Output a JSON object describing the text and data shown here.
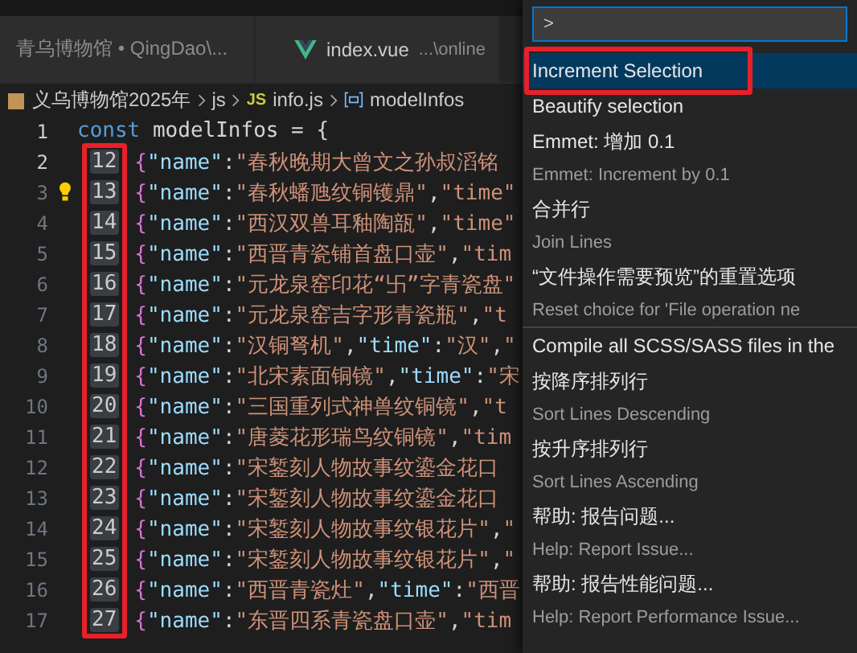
{
  "tabs": [
    {
      "label": "青乌博物馆 • QingDao\\...",
      "kind": "plain",
      "selected": false
    },
    {
      "label": "index.vue",
      "detail": "...\\online",
      "kind": "vue",
      "selected": false
    }
  ],
  "breadcrumb": [
    {
      "label": "义乌博物馆2025年",
      "kind": "folder"
    },
    {
      "label": "js",
      "kind": "plain"
    },
    {
      "label": "info.js",
      "kind": "js",
      "badge": "JS"
    },
    {
      "label": "modelInfos",
      "kind": "symbol"
    }
  ],
  "code": {
    "first_line": {
      "number": "1",
      "text": "const modelInfos = {"
    },
    "lines": [
      {
        "number": "2",
        "cursor": "12",
        "text": "{\"name\":\"春秋晚期大曾文之孙叔滔铭",
        "lightbulb": false,
        "current": true
      },
      {
        "number": "3",
        "cursor": "13",
        "text": "{\"name\":\"春秋蟠虺纹铜镬鼎\",\"time\"",
        "lightbulb": true,
        "current": false
      },
      {
        "number": "4",
        "cursor": "14",
        "text": "{\"name\":\"西汉双兽耳釉陶瓿\",\"time\"",
        "lightbulb": false,
        "current": false
      },
      {
        "number": "5",
        "cursor": "15",
        "text": "{\"name\":\"西晋青瓷铺首盘口壶\",\"tim",
        "lightbulb": false,
        "current": false
      },
      {
        "number": "6",
        "cursor": "16",
        "text": "{\"name\":\"元龙泉窑印花“卐”字青瓷盘\"",
        "lightbulb": false,
        "current": false
      },
      {
        "number": "7",
        "cursor": "17",
        "text": "{\"name\":\"元龙泉窑吉字形青瓷瓶\",\"t",
        "lightbulb": false,
        "current": false
      },
      {
        "number": "8",
        "cursor": "18",
        "text": "{\"name\":\"汉铜弩机\",\"time\":\"汉\",\"",
        "lightbulb": false,
        "current": false
      },
      {
        "number": "9",
        "cursor": "19",
        "text": "{\"name\":\"北宋素面铜镜\",\"time\":\"宋",
        "lightbulb": false,
        "current": false
      },
      {
        "number": "10",
        "cursor": "20",
        "text": "{\"name\":\"三国重列式神兽纹铜镜\",\"t",
        "lightbulb": false,
        "current": false
      },
      {
        "number": "11",
        "cursor": "21",
        "text": "{\"name\":\"唐菱花形瑞鸟纹铜镜\",\"tim",
        "lightbulb": false,
        "current": false
      },
      {
        "number": "12",
        "cursor": "22",
        "text": "{\"name\":\"宋錾刻人物故事纹鎏金花口",
        "lightbulb": false,
        "current": false
      },
      {
        "number": "13",
        "cursor": "23",
        "text": "{\"name\":\"宋錾刻人物故事纹鎏金花口",
        "lightbulb": false,
        "current": false
      },
      {
        "number": "14",
        "cursor": "24",
        "text": "{\"name\":\"宋錾刻人物故事纹银花片\",\"",
        "lightbulb": false,
        "current": false
      },
      {
        "number": "15",
        "cursor": "25",
        "text": "{\"name\":\"宋錾刻人物故事纹银花片\",\"",
        "lightbulb": false,
        "current": false
      },
      {
        "number": "16",
        "cursor": "26",
        "text": "{\"name\":\"西晋青瓷灶\",\"time\":\"西晋",
        "lightbulb": false,
        "current": false
      },
      {
        "number": "17",
        "cursor": "27",
        "text": "{\"name\":\"东晋四系青瓷盘口壶\",\"tim",
        "lightbulb": false,
        "current": false
      }
    ]
  },
  "command_palette": {
    "input": ">",
    "items": [
      {
        "label": "Increment Selection",
        "selected": true,
        "separator": false,
        "annotated": true
      },
      {
        "label": "Beautify selection",
        "selected": false,
        "separator": false,
        "annotated": false
      },
      {
        "label": "Emmet: 增加 0.1",
        "detail": "Emmet: Increment by 0.1",
        "selected": false,
        "separator": false,
        "annotated": false
      },
      {
        "label": "合并行",
        "detail": "Join Lines",
        "selected": false,
        "separator": false,
        "annotated": false
      },
      {
        "label": "“文件操作需要预览”的重置选项",
        "detail": "Reset choice for 'File operation ne",
        "selected": false,
        "separator": false,
        "annotated": false
      },
      {
        "label": "Compile all SCSS/SASS files in the",
        "selected": false,
        "separator": true,
        "annotated": false
      },
      {
        "label": "按降序排列行",
        "detail": "Sort Lines Descending",
        "selected": false,
        "separator": false,
        "annotated": false
      },
      {
        "label": "按升序排列行",
        "detail": "Sort Lines Ascending",
        "selected": false,
        "separator": false,
        "annotated": false
      },
      {
        "label": "帮助: 报告问题...",
        "detail": "Help: Report Issue...",
        "selected": false,
        "separator": false,
        "annotated": false
      },
      {
        "label": "帮助: 报告性能问题...",
        "detail": "Help: Report Performance Issue...",
        "selected": false,
        "separator": false,
        "annotated": false
      }
    ]
  }
}
